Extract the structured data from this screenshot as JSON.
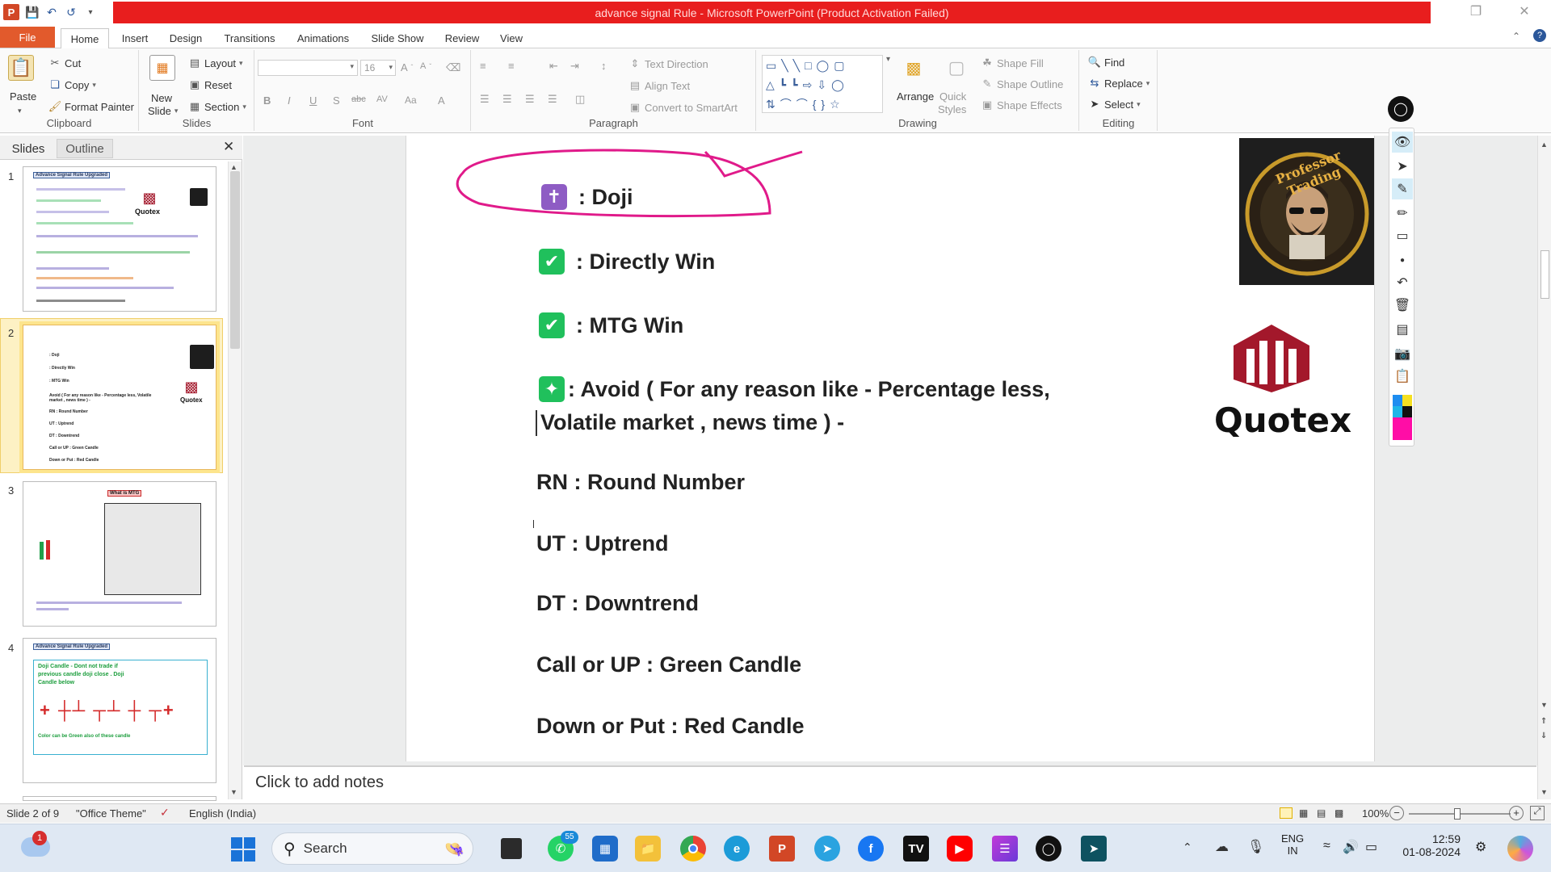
{
  "window": {
    "title": "advance signal Rule  -  Microsoft PowerPoint (Product Activation Failed)"
  },
  "ribbon": {
    "tabs": [
      "File",
      "Home",
      "Insert",
      "Design",
      "Transitions",
      "Animations",
      "Slide Show",
      "Review",
      "View"
    ],
    "clipboard": {
      "paste": "Paste",
      "cut": "Cut",
      "copy": "Copy",
      "format_painter": "Format Painter",
      "label": "Clipboard"
    },
    "slides": {
      "new_slide_line1": "New",
      "new_slide_line2": "Slide",
      "layout": "Layout",
      "reset": "Reset",
      "section": "Section",
      "label": "Slides"
    },
    "font": {
      "font_size": "16",
      "label": "Font"
    },
    "paragraph": {
      "text_direction": "Text Direction",
      "align_text": "Align Text",
      "convert_smartart": "Convert to SmartArt",
      "label": "Paragraph"
    },
    "drawing": {
      "arrange": "Arrange",
      "quick_styles_line1": "Quick",
      "quick_styles_line2": "Styles",
      "shape_fill": "Shape Fill",
      "shape_outline": "Shape Outline",
      "shape_effects": "Shape Effects",
      "label": "Drawing"
    },
    "editing": {
      "find": "Find",
      "replace": "Replace",
      "select": "Select",
      "label": "Editing"
    }
  },
  "slides_pane": {
    "tabs": [
      "Slides",
      "Outline"
    ],
    "thumbnails": [
      {
        "number": "1",
        "header": "Advance Signal Rule Upgraded",
        "brand": "Quotex"
      },
      {
        "number": "2",
        "brand": "Quotex",
        "lines": [
          ": Doji",
          ": Directly Win",
          ": MTG Win",
          "Avoid ( For any reason like - Percentage less, Volatile market , news time ) -",
          "RN : Round Number",
          "UT : Uptrend",
          "DT : Downtrend",
          "Call or UP : Green Candle",
          "Down or Put : Red Candle"
        ]
      },
      {
        "number": "3",
        "header": "What is MTG"
      },
      {
        "number": "4",
        "header": "Advance Signal Rule Upgraded",
        "doji_text": "Doji Candle - Dont not trade if previous candle doji close . Doji Candle below",
        "color_note": "Color can be Green also of these candle"
      }
    ]
  },
  "slide": {
    "lines": {
      "doji": ": Doji",
      "directly_win": ": Directly Win",
      "mtg_win": ": MTG Win",
      "avoid_1": ":  Avoid ( For any reason like - Percentage less,",
      "avoid_2": "Volatile market , news time ) -",
      "rn": "RN : Round Number",
      "ut": "UT : Uptrend",
      "dt": "DT : Downtrend",
      "call": "Call or UP  : Green Candle",
      "put": "Down or Put  : Red Candle"
    },
    "logo_text": "Quotex",
    "avatar_ring_text": "Professor Trading"
  },
  "notes": {
    "placeholder": "Click to add notes"
  },
  "status": {
    "slide_of": "Slide 2 of 9",
    "theme": "\"Office Theme\"",
    "language": "English (India)",
    "zoom": "100%"
  },
  "taskbar": {
    "search": "Search",
    "weather_badge": "1",
    "whatsapp_badge": "55",
    "lang_1": "ENG",
    "lang_2": "IN",
    "time": "12:59",
    "date": "01-08-2024"
  },
  "colors": {
    "title_red": "#e81e1e",
    "file_tab": "#e25a2c",
    "check_green": "#20c05c",
    "doji_purple": "#8e5cc4",
    "annotation_pink": "#e01a8a",
    "quotex_red": "#a3182b"
  }
}
